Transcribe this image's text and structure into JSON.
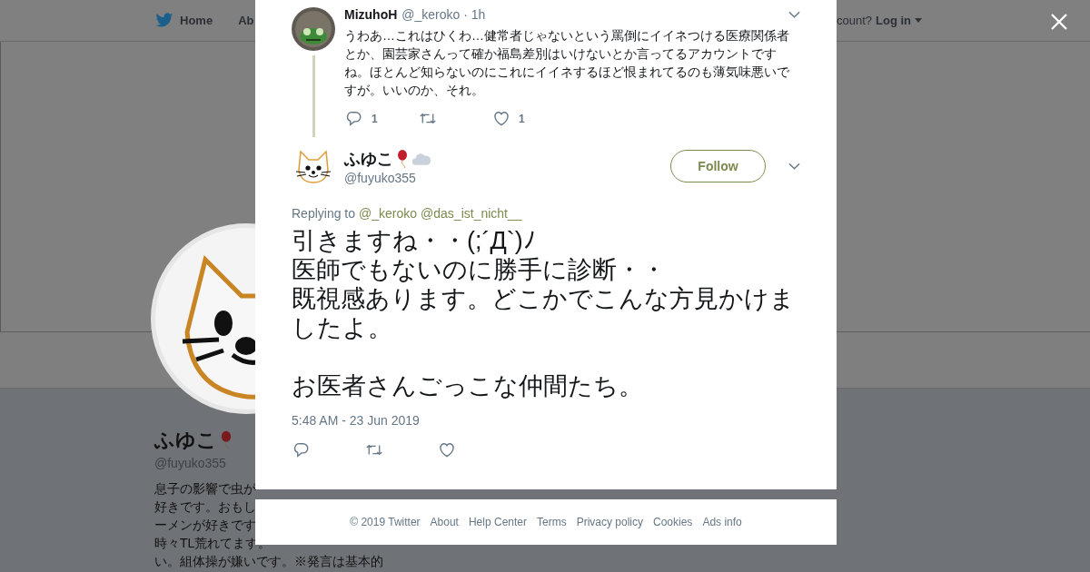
{
  "top_nav": {
    "items": [
      {
        "label": "Home"
      },
      {
        "label": "Ab"
      }
    ],
    "login_prompt": "count?",
    "login": "Log in"
  },
  "profile": {
    "name": "ふゆこ",
    "handle": "@fuyuko355",
    "bio_lines": [
      "息子の影響で虫が",
      "好きです。おもし",
      "ーメンが好きです",
      "時々TL荒れてます。",
      "い。組体操が嫌いです。※発言は基本的"
    ]
  },
  "tweet_modal": {
    "parent_tweet": {
      "name": "MizuhoH",
      "meta": "@_keroko · 1h",
      "text": "うわあ…これはひくわ…健常者じゃないという罵倒にイイネつける医療関係者とか、園芸家さんって確か福島差別はいけないとか言ってるアカウントですね。ほとんど知らないのにこれにイイネするほど恨まれてるのも薄気味悪いですが。いいのか、それ。",
      "replies": "1",
      "likes": "1"
    },
    "tweet": {
      "name": "ふゆこ",
      "handle": "@fuyuko355",
      "follow": "Follow",
      "replying_label": "Replying to",
      "replying_to": [
        "@_keroko",
        "@das_ist_nicht__"
      ],
      "paragraphs": [
        [
          "引きますね・・(;´Д`)ﾉ",
          "医師でもないのに勝手に診断・・",
          "既視感あります。どこかでこんな方見かけましたよ。"
        ],
        [
          "お医者さんごっこな仲間たち。"
        ]
      ],
      "timestamp": "5:48 AM - 23 Jun 2019"
    }
  },
  "footer": {
    "links": [
      "© 2019 Twitter",
      "About",
      "Help Center",
      "Terms",
      "Privacy policy",
      "Cookies",
      "Ads info"
    ]
  }
}
